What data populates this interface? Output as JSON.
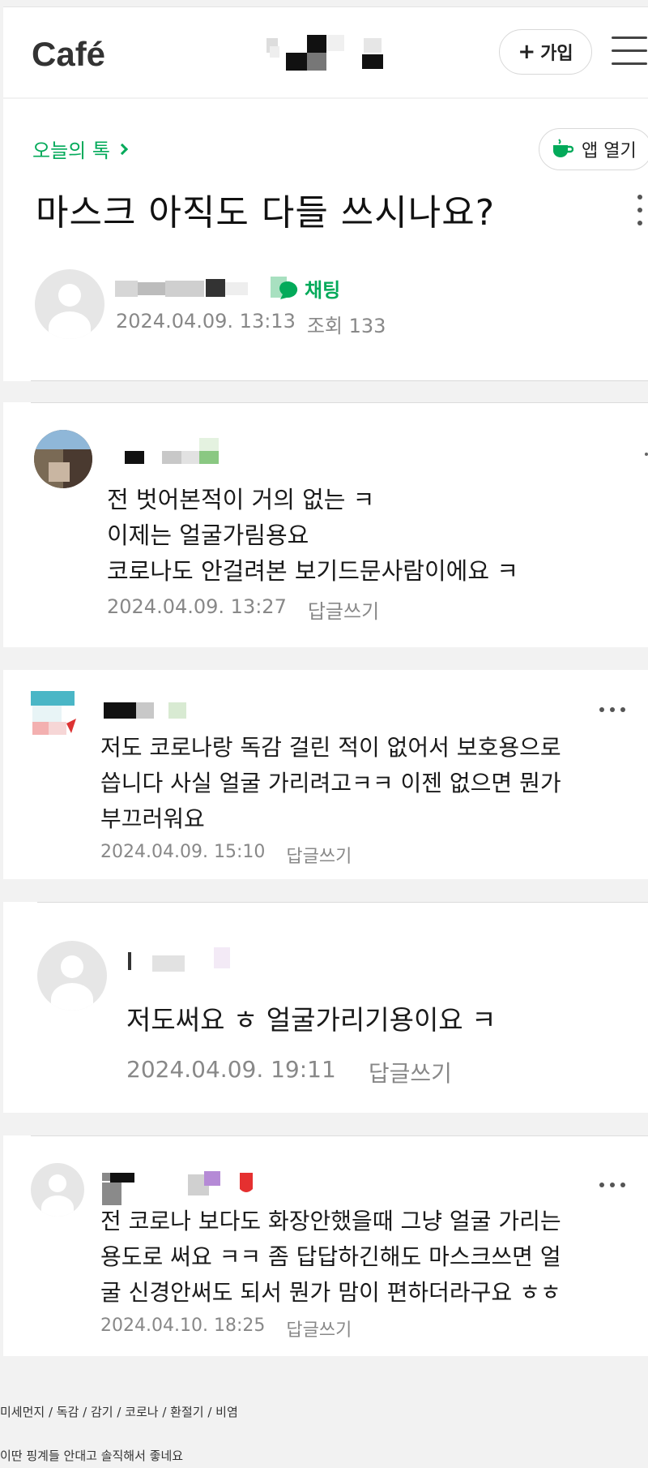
{
  "header": {
    "logo": "Café",
    "join_plus": "+",
    "join_label": "가입"
  },
  "post": {
    "board_link": "오늘의 톡",
    "app_open_label": "앱 열기",
    "title": "마스크 아직도 다들 쓰시나요?",
    "chat_label": "채팅",
    "date": "2024.04.09. 13:13",
    "views_label": "조회 133"
  },
  "comments": [
    {
      "lines": [
        "전 벗어본적이 거의 없는 ㅋ",
        "이제는 얼굴가림용요",
        "코로나도 안걸려본 보기드문사람이에요 ㅋ"
      ],
      "date": "2024.04.09. 13:27",
      "reply_label": "답글쓰기"
    },
    {
      "lines": [
        "저도 코로나랑 독감 걸린 적이 없어서 보호용으로",
        "씁니다 사실 얼굴 가리려고ㅋㅋ 이젠 없으면 뭔가",
        "부끄러워요"
      ],
      "date": "2024.04.09. 15:10",
      "reply_label": "답글쓰기"
    },
    {
      "lines": [
        "저도써요 ㅎ 얼굴가리기용이요 ㅋ"
      ],
      "date": "2024.04.09. 19:11",
      "reply_label": "답글쓰기"
    },
    {
      "lines": [
        "전 코로나 보다도 화장안했을때 그냥 얼굴 가리는",
        "용도로 써요 ㅋㅋ 좀 답답하긴해도 마스크쓰면 얼",
        "굴 신경안써도 되서 뭔가 맘이 편하더라구요 ㅎㅎ"
      ],
      "date": "2024.04.10. 18:25",
      "reply_label": "답글쓰기"
    }
  ],
  "footer": {
    "tags": "미세먼지 / 독감 / 감기 / 코로나 / 환절기 / 비염",
    "caption": "이딴 핑계들 안대고 솔직해서 좋네요"
  },
  "colors": {
    "accent_green": "#03aa5a",
    "meta_gray": "#888888",
    "background": "#f2f2f2"
  },
  "icons": [
    "menu-icon",
    "chevron-right-icon",
    "coffee-cup-icon",
    "more-vertical-icon",
    "chat-bubble-icon",
    "more-horizontal-icon",
    "default-avatar-icon"
  ]
}
